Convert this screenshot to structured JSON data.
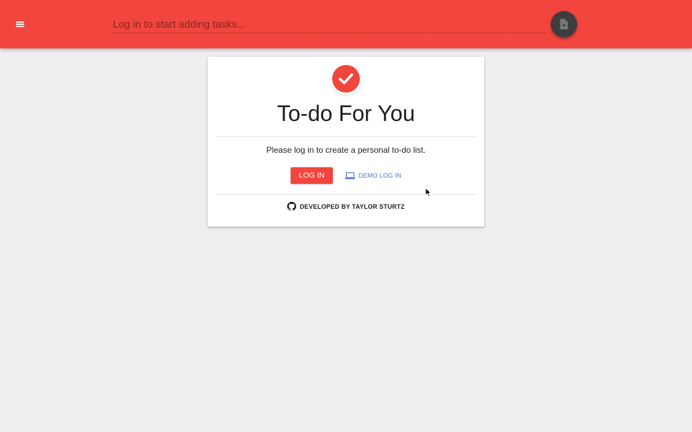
{
  "header": {
    "task_placeholder": "Log in to start adding tasks...",
    "accent_color": "#f1453d",
    "menu_icon": "menu-icon",
    "fab_icon": "file-import-icon"
  },
  "card": {
    "logo_icon": "check-circle-icon",
    "title": "To-do For You",
    "prompt": "Please log in to create a personal to-do list.",
    "login_label": "LOG IN",
    "demo_label": "DEMO LOG IN",
    "demo_icon": "laptop-icon",
    "footer_icon": "github-icon",
    "footer_label": "DEVELOPED BY TAYLOR STURTZ"
  }
}
